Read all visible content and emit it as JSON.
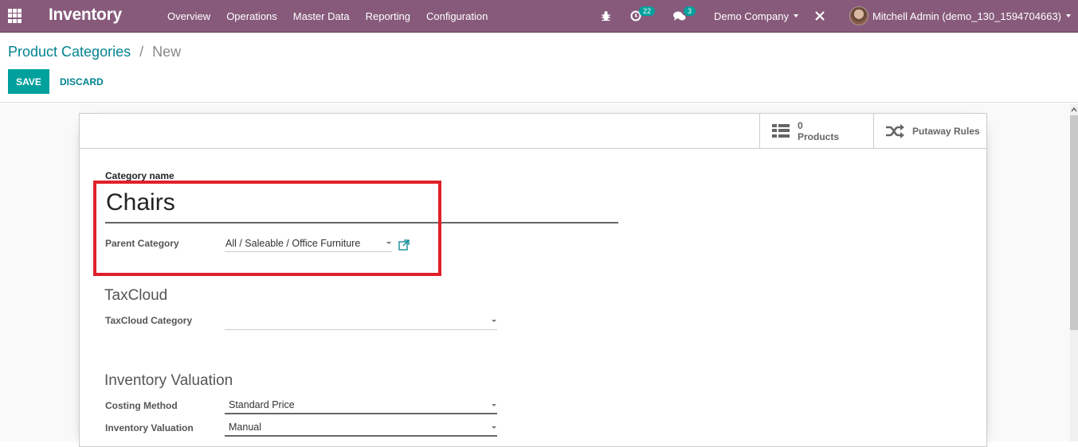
{
  "navbar": {
    "app_name": "Inventory",
    "menu": [
      "Overview",
      "Operations",
      "Master Data",
      "Reporting",
      "Configuration"
    ],
    "activities_count": "22",
    "messages_count": "3",
    "company": "Demo Company",
    "user": "Mitchell Admin (demo_130_1594704663)",
    "accent_color": "#875a7b"
  },
  "breadcrumb": {
    "parent": "Product Categories",
    "separator": "/",
    "current": "New"
  },
  "buttons": {
    "save": "SAVE",
    "discard": "DISCARD"
  },
  "stat_buttons": {
    "products_count": "0",
    "products_label": "Products",
    "putaway_label": "Putaway Rules"
  },
  "form": {
    "category_name_label": "Category name",
    "category_name_value": "Chairs",
    "parent_category_label": "Parent Category",
    "parent_category_value": "All / Saleable / Office Furniture",
    "taxcloud_title": "TaxCloud",
    "taxcloud_category_label": "TaxCloud Category",
    "taxcloud_category_value": "",
    "valuation_title": "Inventory Valuation",
    "costing_method_label": "Costing Method",
    "costing_method_value": "Standard Price",
    "inventory_valuation_label": "Inventory Valuation",
    "inventory_valuation_value": "Manual"
  },
  "annotation": {
    "highlight_color": "#e0202a"
  }
}
